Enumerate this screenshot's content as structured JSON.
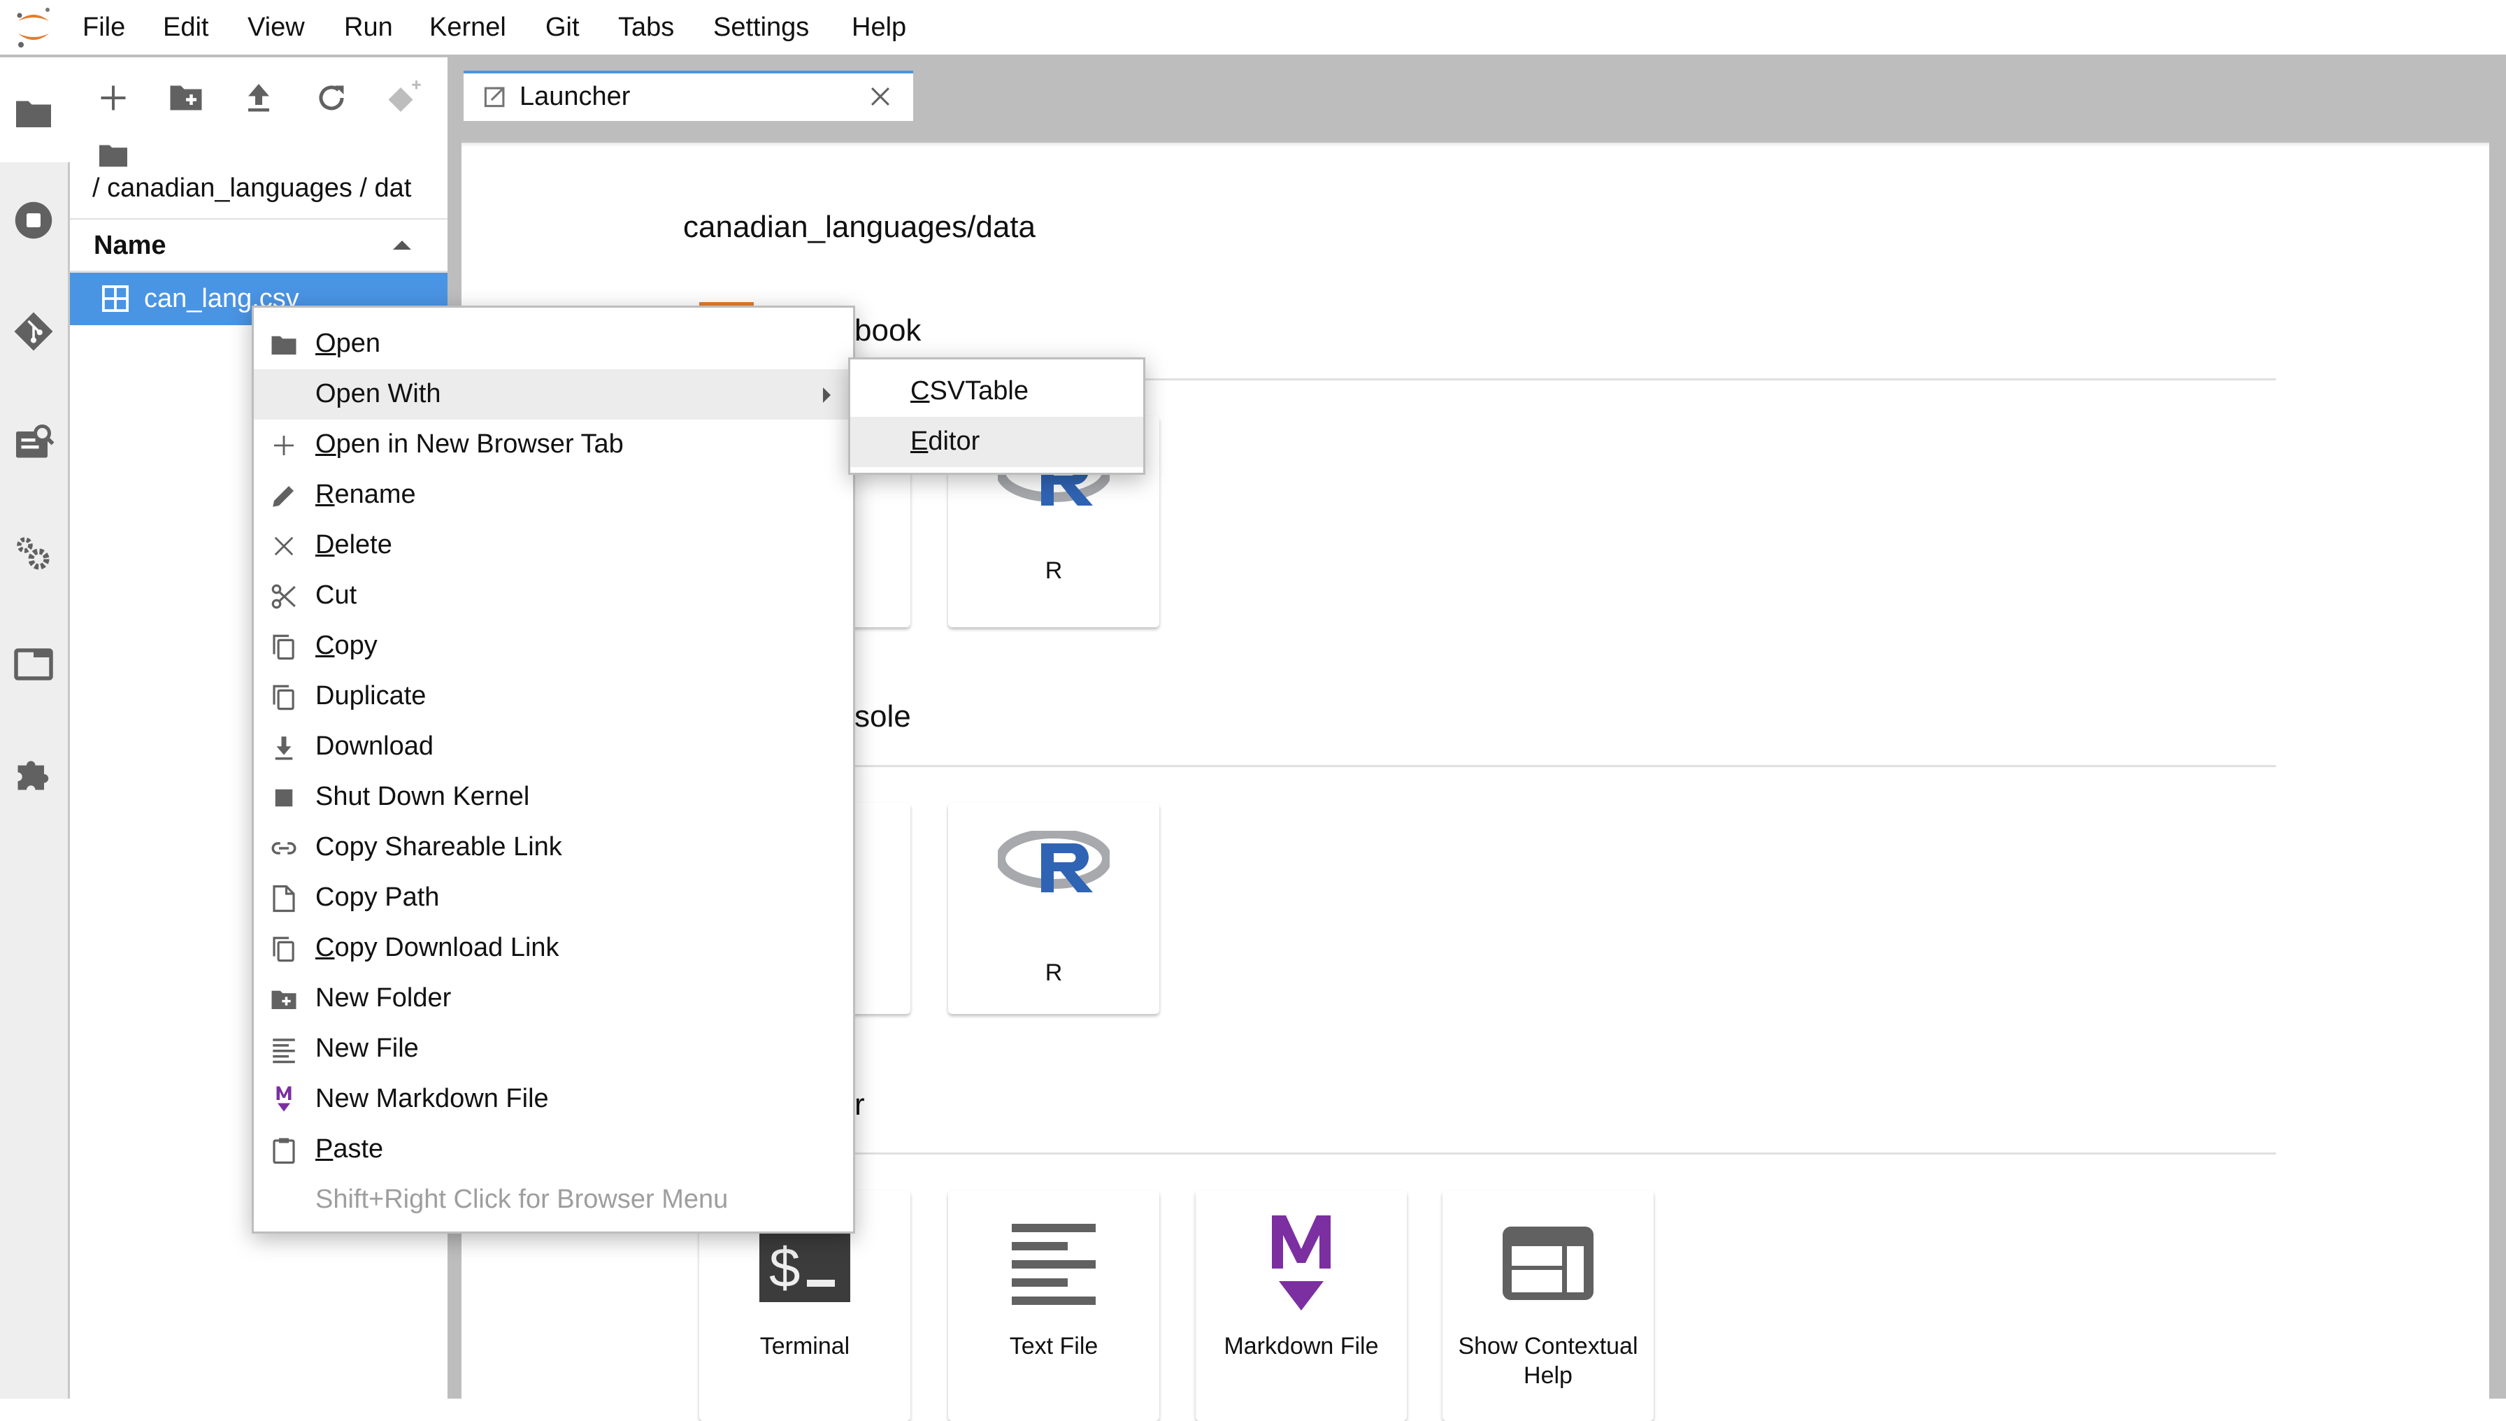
{
  "menubar": {
    "items": [
      "File",
      "Edit",
      "View",
      "Run",
      "Kernel",
      "Git",
      "Tabs",
      "Settings",
      "Help"
    ]
  },
  "sidebar": {
    "icons": [
      "folder-icon",
      "running-sessions-icon",
      "git-icon",
      "table-of-contents-icon",
      "property-inspector-icon",
      "tabs-icon",
      "extension-manager-icon"
    ],
    "active": "folder-icon"
  },
  "filebrowser": {
    "toolbar": [
      "new-launcher",
      "new-folder",
      "upload",
      "refresh",
      "git-clone"
    ],
    "path": "/ canadian_languages / dat",
    "column_header": "Name",
    "sort": "ascending",
    "files": [
      {
        "name": "can_lang.csv",
        "type": "csv",
        "selected": true
      }
    ]
  },
  "tabs": [
    {
      "label": "Launcher",
      "active": true
    }
  ],
  "launcher": {
    "path": "canadian_languages/data",
    "sections": [
      {
        "title": "Notebook",
        "visible_title": "book",
        "cards": [
          {
            "label": "R"
          }
        ]
      },
      {
        "title": "Console",
        "visible_title": "sole",
        "cards": [
          {
            "label": "R"
          }
        ]
      },
      {
        "title": "Other",
        "visible_title": "r",
        "cards": [
          {
            "label": "Terminal"
          },
          {
            "label": "Text File"
          },
          {
            "label": "Markdown File"
          },
          {
            "label": "Show Contextual Help"
          }
        ]
      }
    ]
  },
  "context_menu": {
    "items": [
      {
        "icon": "folder-icon",
        "pre": "",
        "u": "O",
        "post": "pen"
      },
      {
        "icon": "",
        "pre": "Open With",
        "u": "",
        "post": "",
        "submenu": true,
        "hover": true
      },
      {
        "icon": "plus-icon",
        "pre": "",
        "u": "O",
        "post": "pen in New Browser Tab"
      },
      {
        "icon": "pencil-icon",
        "pre": "",
        "u": "R",
        "post": "ename"
      },
      {
        "icon": "close-icon",
        "pre": "",
        "u": "D",
        "post": "elete"
      },
      {
        "icon": "scissors-icon",
        "pre": "Cut",
        "u": "",
        "post": ""
      },
      {
        "icon": "copy-icon",
        "pre": "",
        "u": "C",
        "post": "opy"
      },
      {
        "icon": "copy-icon",
        "pre": "Duplicate",
        "u": "",
        "post": ""
      },
      {
        "icon": "download-icon",
        "pre": "Download",
        "u": "",
        "post": ""
      },
      {
        "icon": "stop-icon",
        "pre": "Shut Down Kernel",
        "u": "",
        "post": ""
      },
      {
        "icon": "link-icon",
        "pre": "Copy Shareable Link",
        "u": "",
        "post": ""
      },
      {
        "icon": "file-icon",
        "pre": "Copy Path",
        "u": "",
        "post": ""
      },
      {
        "icon": "copy-icon",
        "pre": "",
        "u": "C",
        "post": "opy Download Link"
      },
      {
        "icon": "new-folder-icon",
        "pre": "New Folder",
        "u": "",
        "post": ""
      },
      {
        "icon": "text-file-icon",
        "pre": "New File",
        "u": "",
        "post": ""
      },
      {
        "icon": "markdown-icon",
        "pre": "New Markdown File",
        "u": "",
        "post": ""
      },
      {
        "icon": "paste-icon",
        "pre": "",
        "u": "P",
        "post": "aste"
      },
      {
        "icon": "",
        "pre": "Shift+Right Click for Browser Menu",
        "u": "",
        "post": "",
        "disabled": true
      }
    ]
  },
  "submenu": {
    "items": [
      {
        "u": "C",
        "post": "SVTable",
        "hover": false
      },
      {
        "u": "E",
        "post": "ditor",
        "hover": true
      }
    ]
  },
  "colors": {
    "accent": "#4a94e4",
    "jupyter_orange": "#e17c2f",
    "markdown_purple": "#7b2fa0",
    "r_blue": "#2f64b4"
  }
}
